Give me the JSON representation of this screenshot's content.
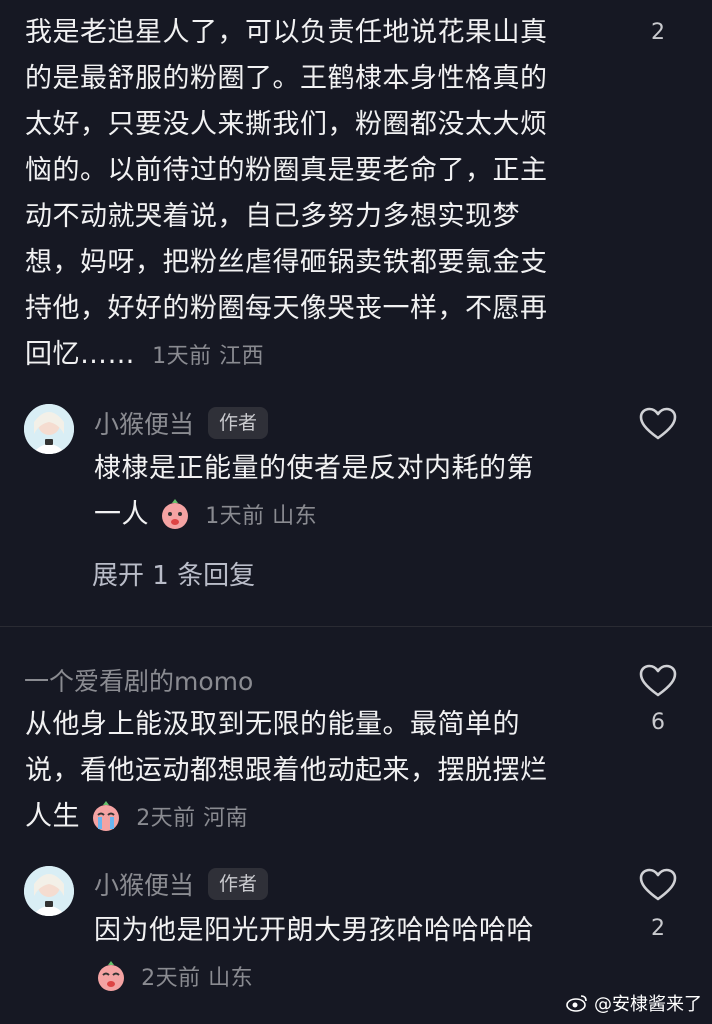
{
  "comments": [
    {
      "lines": [
        "我是老追星人了，可以负责任地说花果山真",
        "的是最舒服的粉圈了。王鹤棣本身性格真的",
        "太好，只要没人来撕我们，粉圈都没太大烦",
        "恼的。以前待过的粉圈真是要老命了，正主",
        "动不动就哭着说，自己多努力多想实现梦",
        "想，妈呀，把粉丝虐得砸锅卖铁都要氪金支",
        "持他，好好的粉圈每天像哭丧一样，不愿再",
        "回忆……"
      ],
      "meta": "1天前  江西",
      "like_count": "2",
      "reply": {
        "username": "小猴便当",
        "badge": "作者",
        "lines": [
          "棣棣是正能量的使者是反对内耗的第",
          "一人"
        ],
        "meta": "1天前  山东"
      },
      "expand_label": "展开 1 条回复"
    },
    {
      "username": "一个爱看剧的momo",
      "lines": [
        "从他身上能汲取到无限的能量。最简单的",
        "说，看他运动都想跟着他动起来，摆脱摆烂",
        "人生"
      ],
      "meta": "2天前  河南",
      "like_count": "6",
      "reply": {
        "username": "小猴便当",
        "badge": "作者",
        "lines": [
          "因为他是阳光开朗大男孩哈哈哈哈哈"
        ],
        "meta": "2天前  山东",
        "like_count": "2"
      }
    }
  ],
  "watermark": "@安棣酱来了",
  "colors": {
    "background": "#161823",
    "text": "#f1f1f2",
    "meta": "#8a8b91",
    "emoji": "#f4a3a3"
  }
}
